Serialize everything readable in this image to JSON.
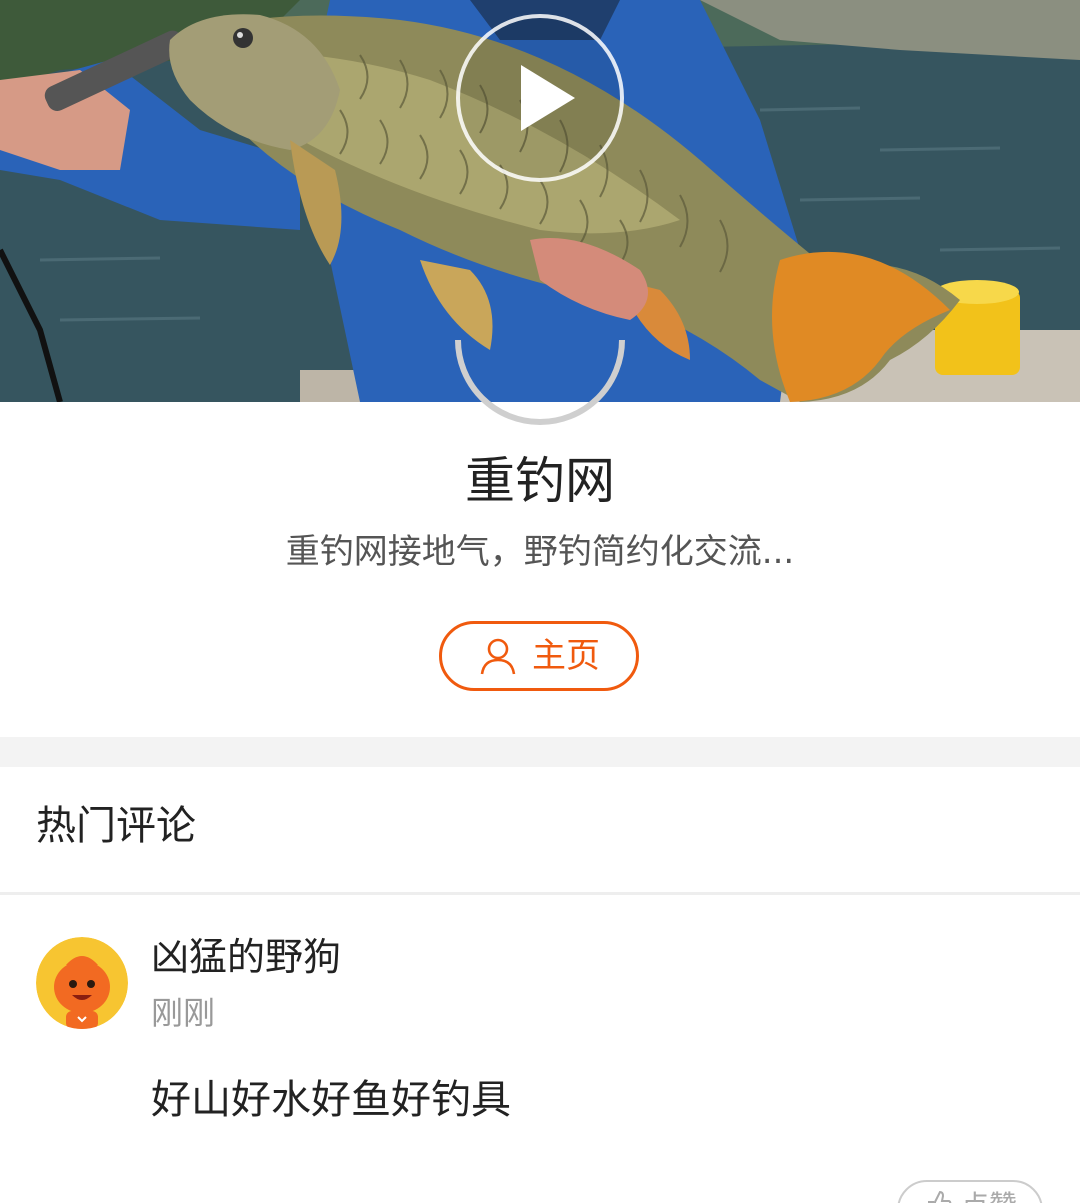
{
  "video": {
    "cover_description_icon": "fish-photo",
    "play_icon": "play-icon"
  },
  "channel": {
    "name": "重钓网",
    "description": "重钓网接地气，野钓简约化交流...",
    "home_button_label": "主页",
    "home_icon": "user-icon"
  },
  "comments_section": {
    "title": "热门评论",
    "items": [
      {
        "username": "凶猛的野狗",
        "time": "刚刚",
        "text": "好山好水好鱼好钓具",
        "like_label": "点赞",
        "like_icon": "thumbs-up-icon"
      }
    ]
  },
  "colors": {
    "accent": "#f05a0e",
    "text_primary": "#222222",
    "text_secondary": "#555555",
    "text_muted": "#999999",
    "section_gap": "#f3f3f3"
  }
}
